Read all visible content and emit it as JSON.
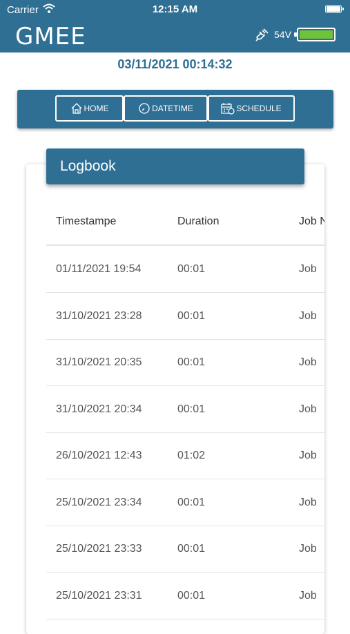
{
  "status_bar": {
    "carrier": "Carrier",
    "time": "12:15 AM"
  },
  "app_bar": {
    "title": "GMEE",
    "voltage": "54V",
    "battery_level": 1.0,
    "battery_color": "#6fc23a"
  },
  "current_datetime": "03/11/2021 00:14:32",
  "nav": {
    "home": "HOME",
    "datetime": "DATETIME",
    "schedule": "SCHEDULE"
  },
  "logbook": {
    "title": "Logbook",
    "columns": [
      "Timestampe",
      "Duration",
      "Job N"
    ],
    "rows": [
      {
        "timestamp": "01/11/2021 19:54",
        "duration": "00:01",
        "job": "Job"
      },
      {
        "timestamp": "31/10/2021 23:28",
        "duration": "00:01",
        "job": "Job"
      },
      {
        "timestamp": "31/10/2021 20:35",
        "duration": "00:01",
        "job": "Job"
      },
      {
        "timestamp": "31/10/2021 20:34",
        "duration": "00:01",
        "job": "Job"
      },
      {
        "timestamp": "26/10/2021 12:43",
        "duration": "01:02",
        "job": "Job"
      },
      {
        "timestamp": "25/10/2021 23:34",
        "duration": "00:01",
        "job": "Job"
      },
      {
        "timestamp": "25/10/2021 23:33",
        "duration": "00:01",
        "job": "Job"
      },
      {
        "timestamp": "25/10/2021 23:31",
        "duration": "00:01",
        "job": "Job"
      }
    ]
  },
  "colors": {
    "primary": "#2f6f94",
    "divider": "#e4e4e4"
  }
}
